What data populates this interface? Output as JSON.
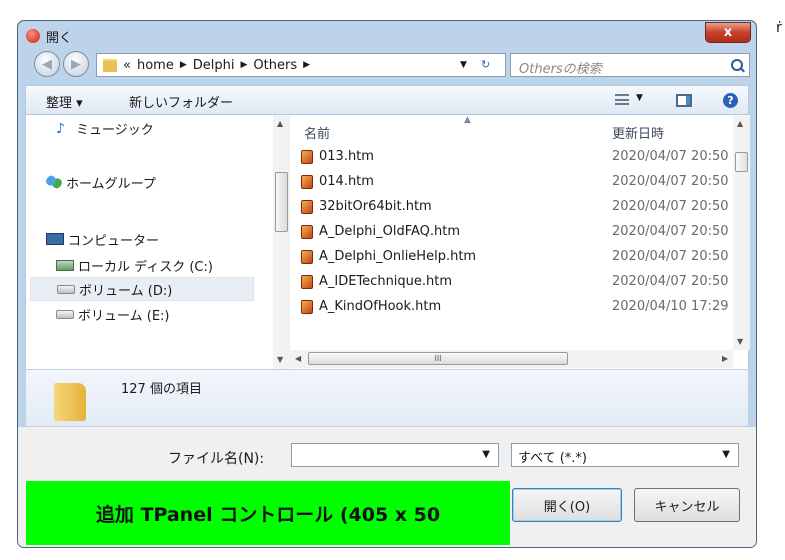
{
  "edge_text": "ṙ",
  "window": {
    "title": "開く",
    "close_label": "x"
  },
  "address": {
    "crumbs": [
      "«",
      "home",
      "Delphi",
      "Others"
    ],
    "search_placeholder": "Othersの検索"
  },
  "toolbar": {
    "organize_label": "整理 ▾",
    "new_folder_label": "新しいフォルダー",
    "help_label": "?"
  },
  "nav": {
    "items": [
      {
        "label": "ミュージック",
        "icon": "music-icon"
      },
      {
        "label": "ホームグループ",
        "icon": "homegroup-icon"
      },
      {
        "label": "コンピューター",
        "icon": "computer-icon"
      },
      {
        "label": "ローカル ディスク (C:)",
        "icon": "local-disk-icon"
      },
      {
        "label": "ボリューム (D:)",
        "icon": "drive-icon",
        "selected": true
      },
      {
        "label": "ボリューム (E:)",
        "icon": "drive-icon"
      }
    ]
  },
  "files": {
    "col_name": "名前",
    "col_date": "更新日時",
    "rows": [
      {
        "name": "013.htm",
        "date": "2020/04/07 20:50"
      },
      {
        "name": "014.htm",
        "date": "2020/04/07 20:50"
      },
      {
        "name": "32bitOr64bit.htm",
        "date": "2020/04/07 20:50"
      },
      {
        "name": "A_Delphi_OldFAQ.htm",
        "date": "2020/04/07 20:50"
      },
      {
        "name": "A_Delphi_OnlieHelp.htm",
        "date": "2020/04/07 20:50"
      },
      {
        "name": "A_IDETechnique.htm",
        "date": "2020/04/07 20:50"
      },
      {
        "name": "A_KindOfHook.htm",
        "date": "2020/04/10 17:29"
      }
    ]
  },
  "details": {
    "item_count": "127 個の項目"
  },
  "footer": {
    "filename_label": "ファイル名(N):",
    "filename_value": "",
    "filetype_value": "すべて (*.*)",
    "panel_text": "追加 TPanel コントロール (405 x 50",
    "open_label": "開く(O)",
    "cancel_label": "キャンセル"
  }
}
